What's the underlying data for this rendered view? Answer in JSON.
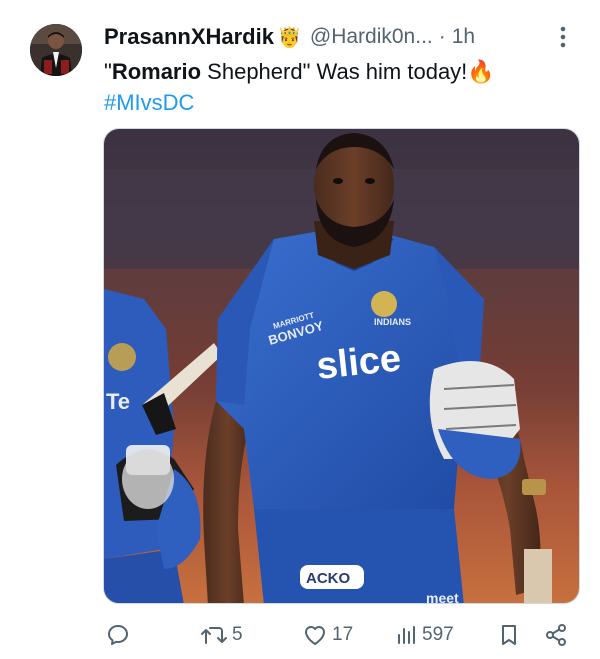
{
  "tweet": {
    "author": {
      "display_name": "PrasannXHardik",
      "badge_emoji": "🤴",
      "handle": "@Hardik0n...",
      "separator": "·",
      "time": "1h"
    },
    "text": {
      "quote_open": "\"",
      "bold_word": "Romario",
      "rest": " Shepherd\" Was him today!",
      "emoji": "🔥",
      "hashtag": "#MIvsDC"
    },
    "media": {
      "jersey_sponsor": "slice",
      "chest_text_1": "MARRIOTT",
      "chest_text_2": "BONVOY",
      "shorts_sponsor": "ACKO",
      "bottom_text": "meet",
      "left_player_text": "Te"
    },
    "actions": {
      "reply_count": "",
      "retweet_count": "5",
      "like_count": "17",
      "views_count": "597"
    }
  },
  "colors": {
    "jersey_blue": "#2f5fbf",
    "link_blue": "#1d9bf0",
    "secondary_text": "#536471"
  },
  "icons": [
    "reply-icon",
    "retweet-icon",
    "like-icon",
    "views-icon",
    "bookmark-icon",
    "share-icon",
    "more-icon"
  ]
}
